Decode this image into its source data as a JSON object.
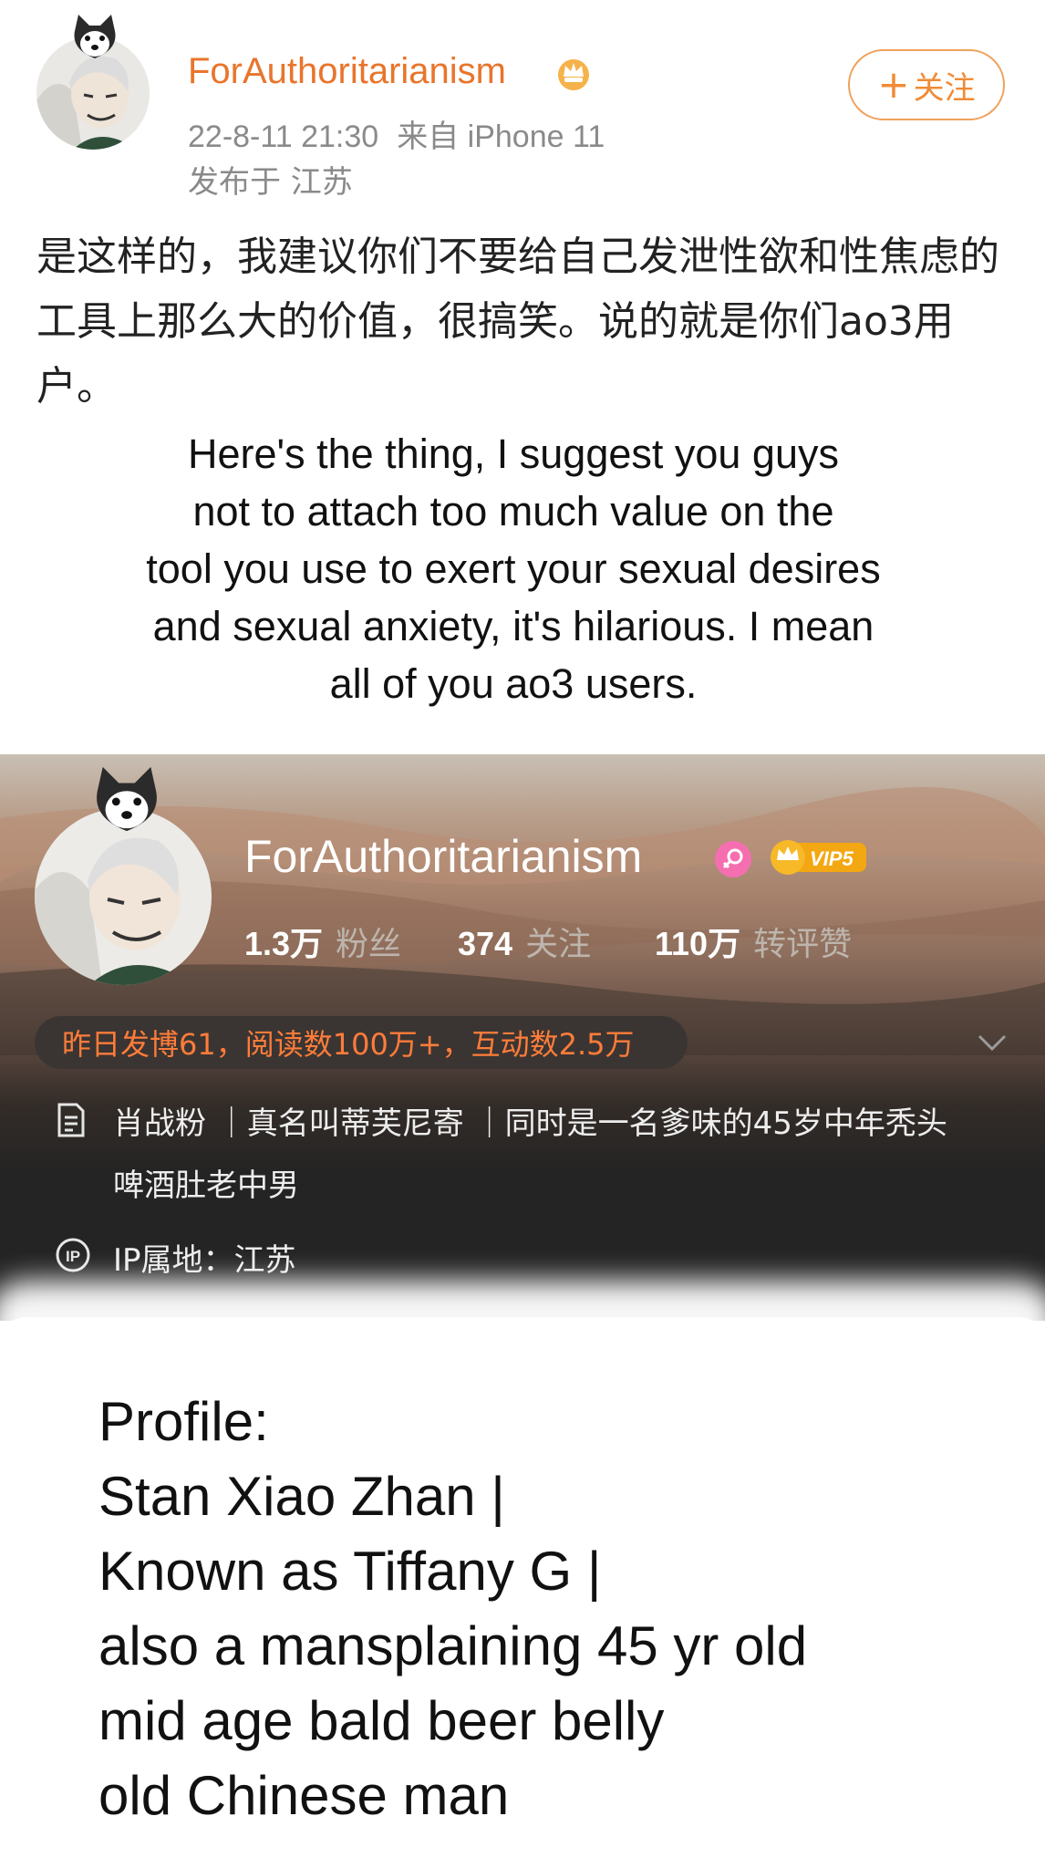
{
  "post": {
    "username": "ForAuthoritarianism",
    "timestamp": "22-8-11 21:30",
    "source": "来自 iPhone 11",
    "location": "发布于 江苏",
    "follow_label": "关注",
    "body": "是这样的，我建议你们不要给自己发泄性欲和性焦虑的工具上那么大的价值，很搞笑。说的就是你们ao3用户。",
    "translation": [
      "Here's the thing, I suggest you guys",
      "not to attach too much value on the",
      "tool you use to exert your sexual desires",
      "and sexual anxiety, it's hilarious. I mean",
      "all of you ao3 users."
    ]
  },
  "profile": {
    "username": "ForAuthoritarianism",
    "vip_label": "VIP5",
    "stats": [
      {
        "value": "1.3万",
        "label": "粉丝"
      },
      {
        "value": "374",
        "label": "关注"
      },
      {
        "value": "110万",
        "label": "转评赞"
      }
    ],
    "activity": "昨日发博61，阅读数100万+，互动数2.5万",
    "description": "肖战粉 ｜真名叫蒂芙尼寄 ｜同时是一名爹味的45岁中年秃头啤酒肚老中男",
    "ip_location": "IP属地：江苏"
  },
  "overlay": {
    "lines": [
      "Profile:",
      "Stan Xiao Zhan |",
      "Known as Tiffany G |",
      "also a mansplaining 45 yr old",
      "mid age bald beer belly",
      "old Chinese man"
    ]
  },
  "colors": {
    "accent_orange": "#e8752c",
    "activity_orange": "#ff7c3a",
    "dark_bg": "#232323",
    "gender_pink": "#f56fb0",
    "vip_gold": "#f3a712"
  },
  "icons": [
    "husky-avatar-decoration",
    "crown-badge-icon",
    "female-icon",
    "vip-badge-icon",
    "chevron-down-icon",
    "document-icon",
    "ip-icon"
  ]
}
